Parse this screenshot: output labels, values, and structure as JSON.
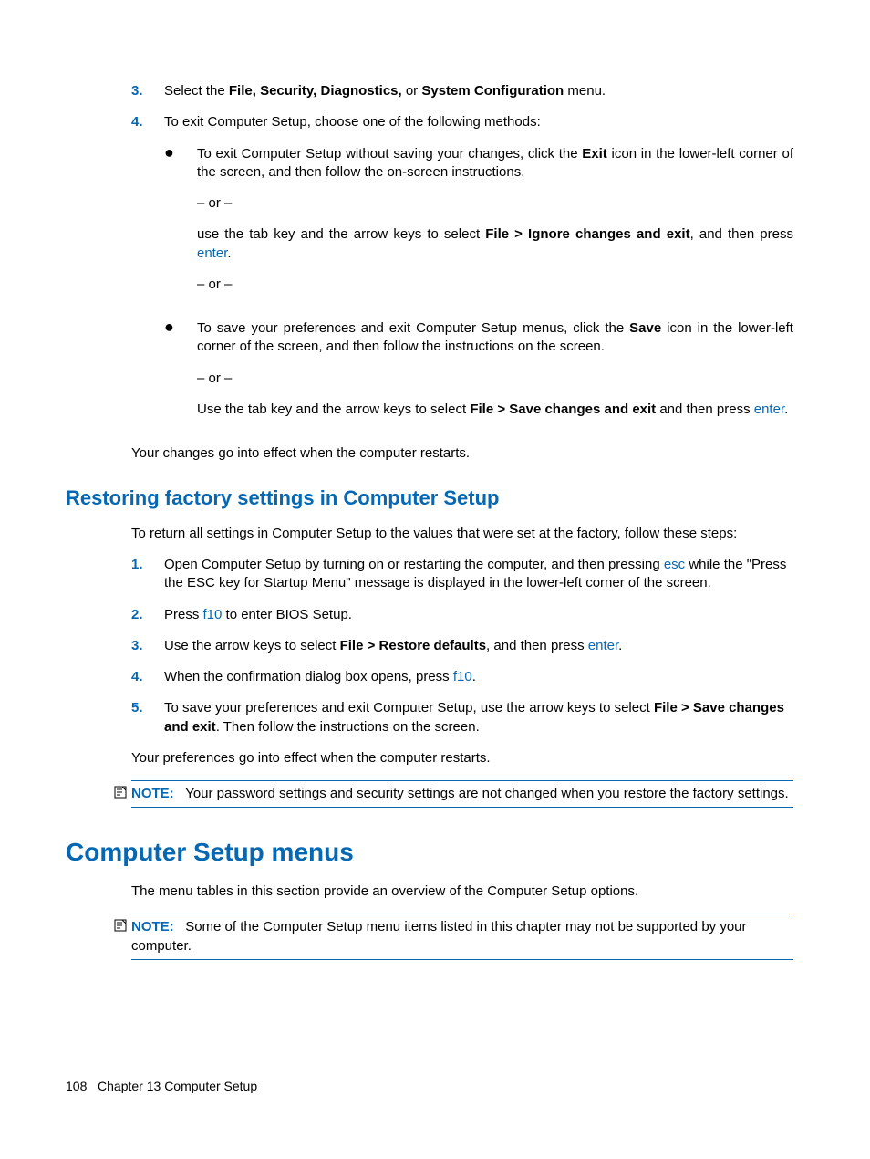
{
  "top_list": {
    "item3_num": "3.",
    "item3_a": "Select the ",
    "item3_b": "File, Security, Diagnostics,",
    "item3_c": " or ",
    "item3_d": "System Configuration",
    "item3_e": " menu.",
    "item4_num": "4.",
    "item4_text": "To exit Computer Setup, choose one of the following methods:",
    "sub1_a": "To exit Computer Setup without saving your changes, click the ",
    "sub1_b": "Exit",
    "sub1_c": " icon in the lower-left corner of the screen, and then follow the on-screen instructions.",
    "or": "– or –",
    "sub1_d": "use the tab key and the arrow keys to select ",
    "sub1_e": "File > Ignore changes and exit",
    "sub1_f": ", and then press ",
    "sub1_g": "enter",
    "sub1_h": ".",
    "sub2_a": "To save your preferences and exit Computer Setup menus, click the ",
    "sub2_b": "Save",
    "sub2_c": " icon in the lower-left corner of the screen, and then follow the instructions on the screen.",
    "sub2_d": "Use the tab key and the arrow keys to select ",
    "sub2_e": "File > Save changes and exit",
    "sub2_f": " and then press ",
    "sub2_g": "enter",
    "sub2_h": ".",
    "closing": "Your changes go into effect when the computer restarts."
  },
  "section2": {
    "heading": "Restoring factory settings in Computer Setup",
    "intro": "To return all settings in Computer Setup to the values that were set at the factory, follow these steps:",
    "s1_num": "1.",
    "s1_a": "Open Computer Setup by turning on or restarting the computer, and then pressing ",
    "s1_b": "esc",
    "s1_c": " while the \"Press the ESC key for Startup Menu\" message is displayed in the lower-left corner of the screen.",
    "s2_num": "2.",
    "s2_a": "Press ",
    "s2_b": "f10",
    "s2_c": " to enter BIOS Setup.",
    "s3_num": "3.",
    "s3_a": "Use the arrow keys to select ",
    "s3_b": "File > Restore defaults",
    "s3_c": ", and then press ",
    "s3_d": "enter",
    "s3_e": ".",
    "s4_num": "4.",
    "s4_a": "When the confirmation dialog box opens, press ",
    "s4_b": "f10",
    "s4_c": ".",
    "s5_num": "5.",
    "s5_a": "To save your preferences and exit Computer Setup, use the arrow keys to select ",
    "s5_b": "File > Save changes and exit",
    "s5_c": ". Then follow the instructions on the screen.",
    "closing": "Your preferences go into effect when the computer restarts.",
    "note_label": "NOTE:",
    "note_text": "Your password settings and security settings are not changed when you restore the factory settings."
  },
  "section3": {
    "heading": "Computer Setup menus",
    "intro": "The menu tables in this section provide an overview of the Computer Setup options.",
    "note_label": "NOTE:",
    "note_text": "Some of the Computer Setup menu items listed in this chapter may not be supported by your computer."
  },
  "footer": {
    "page": "108",
    "chapter": "Chapter 13   Computer Setup"
  }
}
